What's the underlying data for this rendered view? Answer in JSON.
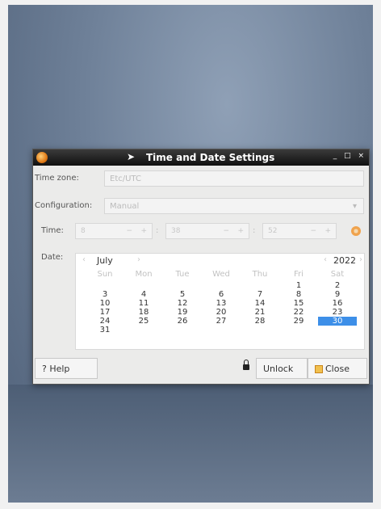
{
  "window": {
    "title": "Time and Date Settings",
    "controls": [
      "_",
      "□",
      "×"
    ]
  },
  "labels": {
    "timezone": "Time zone:",
    "configuration": "Configuration:",
    "time": "Time:",
    "date": "Date:"
  },
  "fields": {
    "timezone_value": "Etc/UTC",
    "configuration_value": "Manual",
    "hour": "8",
    "minute": "38",
    "second": "52",
    "minus": "−",
    "plus": "+",
    "colon": ":"
  },
  "calendar": {
    "month": "July",
    "year": "2022",
    "prev": "‹",
    "next": "›",
    "days_of_week": [
      "Sun",
      "Mon",
      "Tue",
      "Wed",
      "Thu",
      "Fri",
      "Sat"
    ],
    "weeks": [
      [
        "",
        "",
        "",
        "",
        "",
        "1",
        "2"
      ],
      [
        "3",
        "4",
        "5",
        "6",
        "7",
        "8",
        "9"
      ],
      [
        "10",
        "11",
        "12",
        "13",
        "14",
        "15",
        "16"
      ],
      [
        "17",
        "18",
        "19",
        "20",
        "21",
        "22",
        "23"
      ],
      [
        "24",
        "25",
        "26",
        "27",
        "28",
        "29",
        "30"
      ],
      [
        "31",
        "",
        "",
        "",
        "",
        "",
        ""
      ]
    ],
    "selected_day": "30"
  },
  "buttons": {
    "help": "? Help",
    "unlock": "Unlock",
    "close": "Close"
  }
}
